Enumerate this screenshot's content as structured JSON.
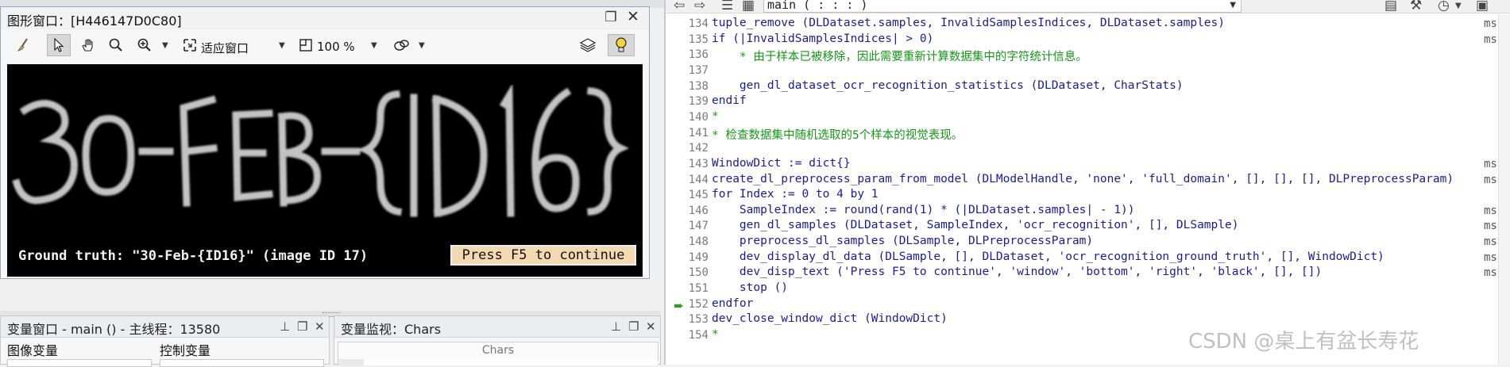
{
  "graphics_window": {
    "title": "图形窗口：[H446147D0C80]",
    "toolbar": {
      "fit_label": "适应窗口",
      "zoom_label": "100 %"
    },
    "image_text": "30-FEB-{ID16}",
    "ground_truth_text": "Ground truth: \"30-Feb-{ID16}\" (image ID 17)",
    "press_text": "Press F5 to continue"
  },
  "variable_window": {
    "title": "变量窗口 - main () - 主线程：13580",
    "col_image": "图像变量",
    "col_control": "控制变量"
  },
  "watch_window": {
    "title": "变量监视：Chars",
    "column_header": "Chars"
  },
  "program_editor": {
    "procedure": "main ( : : : )",
    "lines": [
      {
        "n": "134",
        "text": "tuple_remove (DLDataset.samples, InvalidSamplesIndices, DLDataset.samples)",
        "cls": "kw",
        "ms": "ms"
      },
      {
        "n": "135",
        "text": "if (|InvalidSamplesIndices| > 0)",
        "cls": "kw",
        "ms": "ms"
      },
      {
        "n": "136",
        "text": "    * 由于样本已被移除，因此需要重新计算数据集中的字符统计信息。",
        "cls": "cm",
        "ms": ""
      },
      {
        "n": "137",
        "text": "",
        "cls": "kw",
        "ms": ""
      },
      {
        "n": "138",
        "text": "    gen_dl_dataset_ocr_recognition_statistics (DLDataset, CharStats)",
        "cls": "kw",
        "ms": ""
      },
      {
        "n": "139",
        "text": "endif",
        "cls": "kw",
        "ms": ""
      },
      {
        "n": "140",
        "text": "*",
        "cls": "cm",
        "ms": ""
      },
      {
        "n": "141",
        "text": "* 检查数据集中随机选取的5个样本的视觉表现。",
        "cls": "cm",
        "ms": ""
      },
      {
        "n": "142",
        "text": "",
        "cls": "kw",
        "ms": ""
      },
      {
        "n": "143",
        "text": "WindowDict := dict{}",
        "cls": "kw",
        "ms": "ms"
      },
      {
        "n": "144",
        "text": "create_dl_preprocess_param_from_model (DLModelHandle, 'none', 'full_domain', [], [], [], DLPreprocessParam)",
        "cls": "kw",
        "ms": "ms"
      },
      {
        "n": "145",
        "text": "for Index := 0 to 4 by 1",
        "cls": "kw",
        "ms": ""
      },
      {
        "n": "146",
        "text": "    SampleIndex := round(rand(1) * (|DLDataset.samples| - 1))",
        "cls": "kw",
        "ms": "ms"
      },
      {
        "n": "147",
        "text": "    gen_dl_samples (DLDataset, SampleIndex, 'ocr_recognition', [], DLSample)",
        "cls": "kw",
        "ms": "ms"
      },
      {
        "n": "148",
        "text": "    preprocess_dl_samples (DLSample, DLPreprocessParam)",
        "cls": "kw",
        "ms": "ms"
      },
      {
        "n": "149",
        "text": "    dev_display_dl_data (DLSample, [], DLDataset, 'ocr_recognition_ground_truth', [], WindowDict)",
        "cls": "kw",
        "ms": "ms"
      },
      {
        "n": "150",
        "text": "    dev_disp_text ('Press F5 to continue', 'window', 'bottom', 'right', 'black', [], [])",
        "cls": "kw",
        "ms": "ms"
      },
      {
        "n": "151",
        "text": "    stop ()",
        "cls": "kw",
        "ms": ""
      },
      {
        "n": "152",
        "text": "endfor",
        "cls": "kw",
        "ms": ""
      },
      {
        "n": "153",
        "text": "dev_close_window_dict (WindowDict)",
        "cls": "kw",
        "ms": ""
      },
      {
        "n": "154",
        "text": "*",
        "cls": "cm",
        "ms": ""
      }
    ]
  },
  "watermark": "CSDN @桌上有盆长寿花"
}
